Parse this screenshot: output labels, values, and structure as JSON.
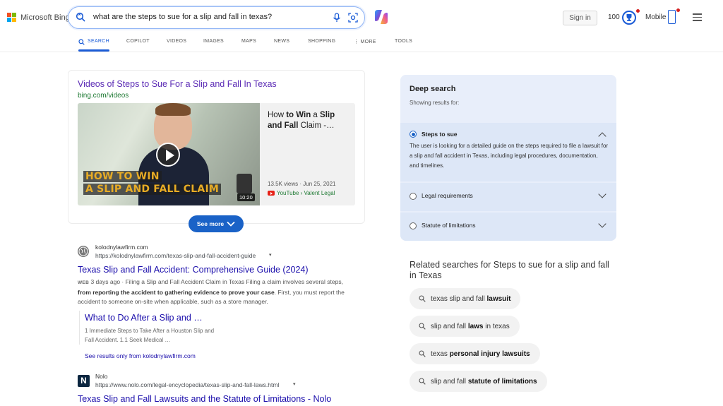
{
  "brand": {
    "name": "Microsoft Bing",
    "colors": [
      "#f25022",
      "#7fba00",
      "#00a4ef",
      "#ffb900"
    ]
  },
  "search": {
    "query": "what are the steps to sue for a slip and fall in texas?"
  },
  "header": {
    "sign_in": "Sign in",
    "points": "100",
    "mobile": "Mobile"
  },
  "tabs": [
    {
      "label": "SEARCH",
      "active": true
    },
    {
      "label": "COPILOT"
    },
    {
      "label": "VIDEOS"
    },
    {
      "label": "IMAGES"
    },
    {
      "label": "MAPS"
    },
    {
      "label": "NEWS"
    },
    {
      "label": "SHOPPING"
    },
    {
      "label": "⋮ MORE"
    },
    {
      "label": "TOOLS"
    }
  ],
  "videos": {
    "title": "Videos of Steps to Sue For a Slip and Fall In Texas",
    "source": "bing.com/videos",
    "thumb_line1": "HOW TO WIN",
    "thumb_line2": "A SLIP AND FALL CLAIM",
    "duration": "10:20",
    "card_title_plain1": "How ",
    "card_title_bold1": "to Win",
    "card_title_plain2": " a ",
    "card_title_bold2": "Slip and Fall",
    "card_title_plain3": " Claim -…",
    "meta": "13.5K views · Jun 25, 2021",
    "channel": "YouTube › Valent Legal",
    "see_more": "See more"
  },
  "results": [
    {
      "site": "kolodnylawfirm.com",
      "url": "https://kolodnylawfirm.com/texas-slip-and-fall-accident-guide",
      "title": "Texas Slip and Fall Accident: Comprehensive Guide (2024)",
      "label": "WEB",
      "snippet_a": "3 days ago · Filing a Slip and Fall Accident Claim in Texas Filing a claim involves several steps, ",
      "snippet_bold": "from reporting the accident to gathering evidence to prove your case",
      "snippet_b": ". First, you must report the accident to someone on-site when applicable, such as a store manager.",
      "sublink_title": "What to Do After a Slip and …",
      "sublink_text": "1 Immediate Steps to Take After a Houston Slip and Fall Accident. 1.1 Seek Medical …",
      "see_site": "See results only from kolodnylawfirm.com"
    },
    {
      "site": "Nolo",
      "url": "https://www.nolo.com/legal-encyclopedia/texas-slip-and-fall-laws.html",
      "title": "Texas Slip and Fall Lawsuits and the Statute of Limitations - Nolo",
      "icon_letter": "N"
    }
  ],
  "deep_search": {
    "title": "Deep search",
    "subtitle": "Showing results for:",
    "items": [
      {
        "label": "Steps to sue",
        "selected": true,
        "expanded": true,
        "description": "The user is looking for a detailed guide on the steps required to file a lawsuit for a slip and fall accident in Texas, including legal procedures, documentation, and timelines."
      },
      {
        "label": "Legal requirements",
        "selected": false
      },
      {
        "label": "Statute of limitations",
        "selected": false
      }
    ]
  },
  "related": {
    "title": "Related searches for Steps to sue for a slip and fall in Texas",
    "items": [
      {
        "plain": "texas slip and fall ",
        "bold": "lawsuit",
        "after": ""
      },
      {
        "plain": "slip and fall ",
        "bold": "laws",
        "after": " in texas"
      },
      {
        "plain": "texas ",
        "bold": "personal injury lawsuits",
        "after": ""
      },
      {
        "plain": "slip and fall ",
        "bold": "statute of limitations",
        "after": ""
      }
    ]
  }
}
